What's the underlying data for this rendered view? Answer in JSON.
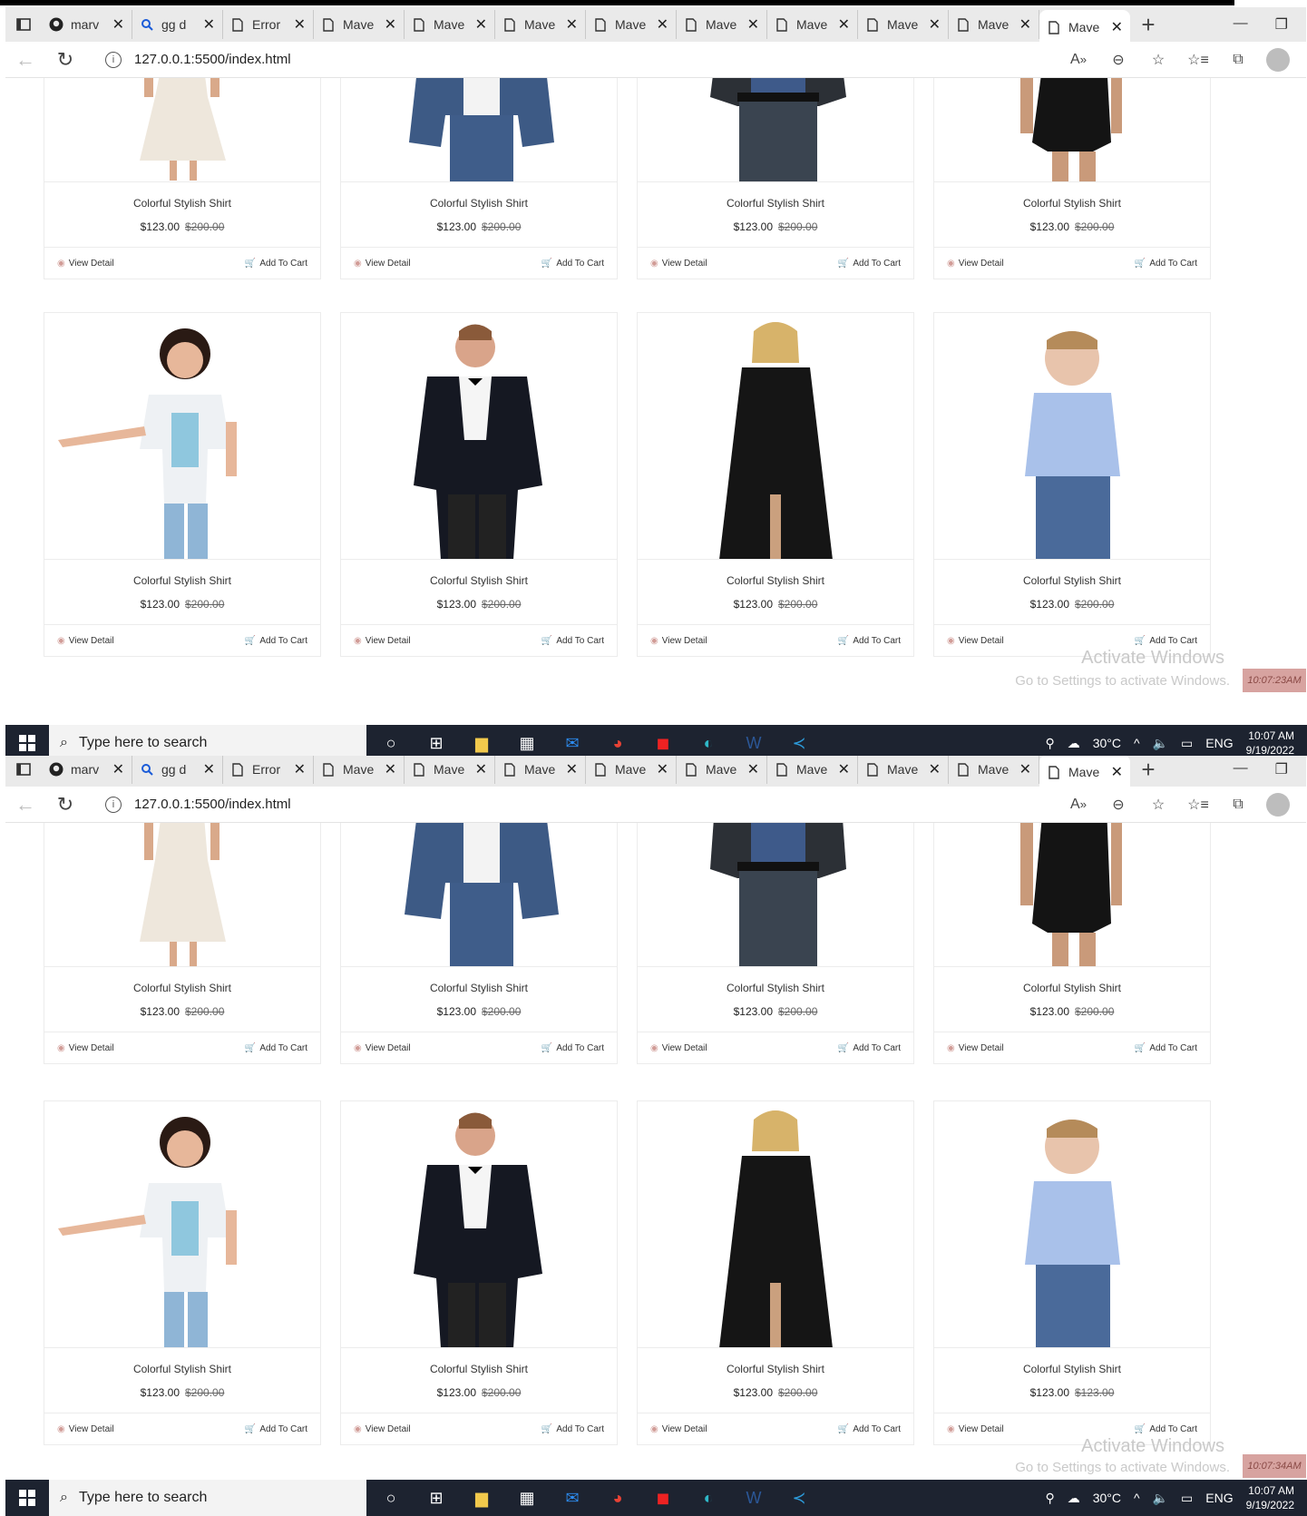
{
  "browser": {
    "tabs": [
      {
        "label": "marv",
        "icon": "github-icon"
      },
      {
        "label": "gg d",
        "icon": "search-icon"
      },
      {
        "label": "Error",
        "icon": "page-icon"
      },
      {
        "label": "Mave",
        "icon": "page-icon"
      },
      {
        "label": "Mave",
        "icon": "page-icon"
      },
      {
        "label": "Mave",
        "icon": "page-icon"
      },
      {
        "label": "Mave",
        "icon": "page-icon"
      },
      {
        "label": "Mave",
        "icon": "page-icon"
      },
      {
        "label": "Mave",
        "icon": "page-icon"
      },
      {
        "label": "Mave",
        "icon": "page-icon"
      },
      {
        "label": "Mave",
        "icon": "page-icon"
      },
      {
        "label": "Mave",
        "icon": "page-icon"
      }
    ],
    "url": "127.0.0.1:5500/index.html"
  },
  "products": {
    "name": "Colorful Stylish Shirt",
    "price": "$123.00",
    "old_price": "$200.00",
    "view_label": "View Detail",
    "cart_label": "Add To Cart",
    "bottom_last_old_price": "$123.00",
    "images": [
      "girl-white-dress",
      "man-denim-jacket",
      "man-dark-jacket",
      "woman-black-dress",
      "girl-printed-tshirt",
      "man-tuxedo",
      "woman-black-coat",
      "boy-blue-shirt"
    ]
  },
  "watermark": {
    "title": "Activate Windows",
    "subtitle": "Go to Settings to activate Windows."
  },
  "recorder": {
    "time_top": "10:07:23AM",
    "time_bottom": "10:07:34AM"
  },
  "taskbar": {
    "search_placeholder": "Type here to search",
    "temperature": "30°C",
    "language": "ENG",
    "time": "10:07 AM",
    "date": "9/19/2022"
  },
  "colors": {
    "accent": "#D19C97",
    "taskbar": "#1D2330"
  }
}
